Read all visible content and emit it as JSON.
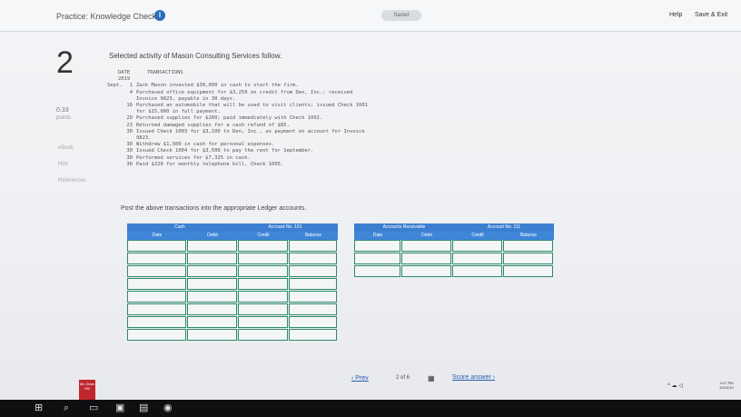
{
  "header": {
    "title": "Practice: Knowledge Check",
    "saved": "Saved",
    "help": "Help",
    "save_exit": "Save & Exit"
  },
  "question": {
    "number": "2",
    "points_value": "0.33",
    "points_label": "points",
    "side_links": [
      "eBook",
      "Hint",
      "References"
    ],
    "prompt": "Selected activity of Mason Consulting Services follow.",
    "date_header": "DATE",
    "year": "2019",
    "tx_header": "TRANSACTIONS",
    "transactions": [
      {
        "month": "Sept.",
        "day": "1",
        "text": "Zack Mason invested $30,000 in cash to start the firm."
      },
      {
        "month": "",
        "day": "4",
        "text": "Purchased office equipment for $3,250 on credit from Den, Inc.; received"
      },
      {
        "month": "",
        "day": "",
        "text": "Invoice 9823, payable in 30 days."
      },
      {
        "month": "",
        "day": "16",
        "text": "Purchased an automobile that will be used to visit clients; issued Check 1001"
      },
      {
        "month": "",
        "day": "",
        "text": "for $15,000 in full payment."
      },
      {
        "month": "",
        "day": "20",
        "text": "Purchased supplies for $260; paid immediately with Check 1002."
      },
      {
        "month": "",
        "day": "23",
        "text": "Returned damaged supplies for a cash refund of $85."
      },
      {
        "month": "",
        "day": "30",
        "text": "Issued Check 1003 for $3,100 to Den, Inc., as payment on account for Invoice"
      },
      {
        "month": "",
        "day": "",
        "text": "9823."
      },
      {
        "month": "",
        "day": "30",
        "text": "Withdrew $1,500 in cash for personal expenses."
      },
      {
        "month": "",
        "day": "30",
        "text": "Issued Check 1004 for $3,500 to pay the rent for September."
      },
      {
        "month": "",
        "day": "30",
        "text": "Performed services for $7,325 in cash."
      },
      {
        "month": "",
        "day": "30",
        "text": "Paid $220 for monthly telephone bill, Check 1005."
      }
    ],
    "post_instruction": "Post the above transactions into the appropriate Ledger accounts."
  },
  "ledgers": [
    {
      "name": "Cash",
      "account_no": "Account No. 101",
      "columns": [
        "Date",
        "Debit",
        "Credit",
        "Balance"
      ]
    },
    {
      "name": "Accounts Receivable",
      "account_no": "Account No. 111",
      "columns": [
        "Date",
        "Debit",
        "Credit",
        "Balance"
      ]
    }
  ],
  "pager": {
    "prev": "Prev",
    "count": "2 of 6",
    "next": "Score answer"
  },
  "logo_text": "Mc Graw Hill",
  "tray": {
    "icons": "^ ☁ ◁",
    "time": "4:27 PM",
    "date": "10/16/19"
  }
}
